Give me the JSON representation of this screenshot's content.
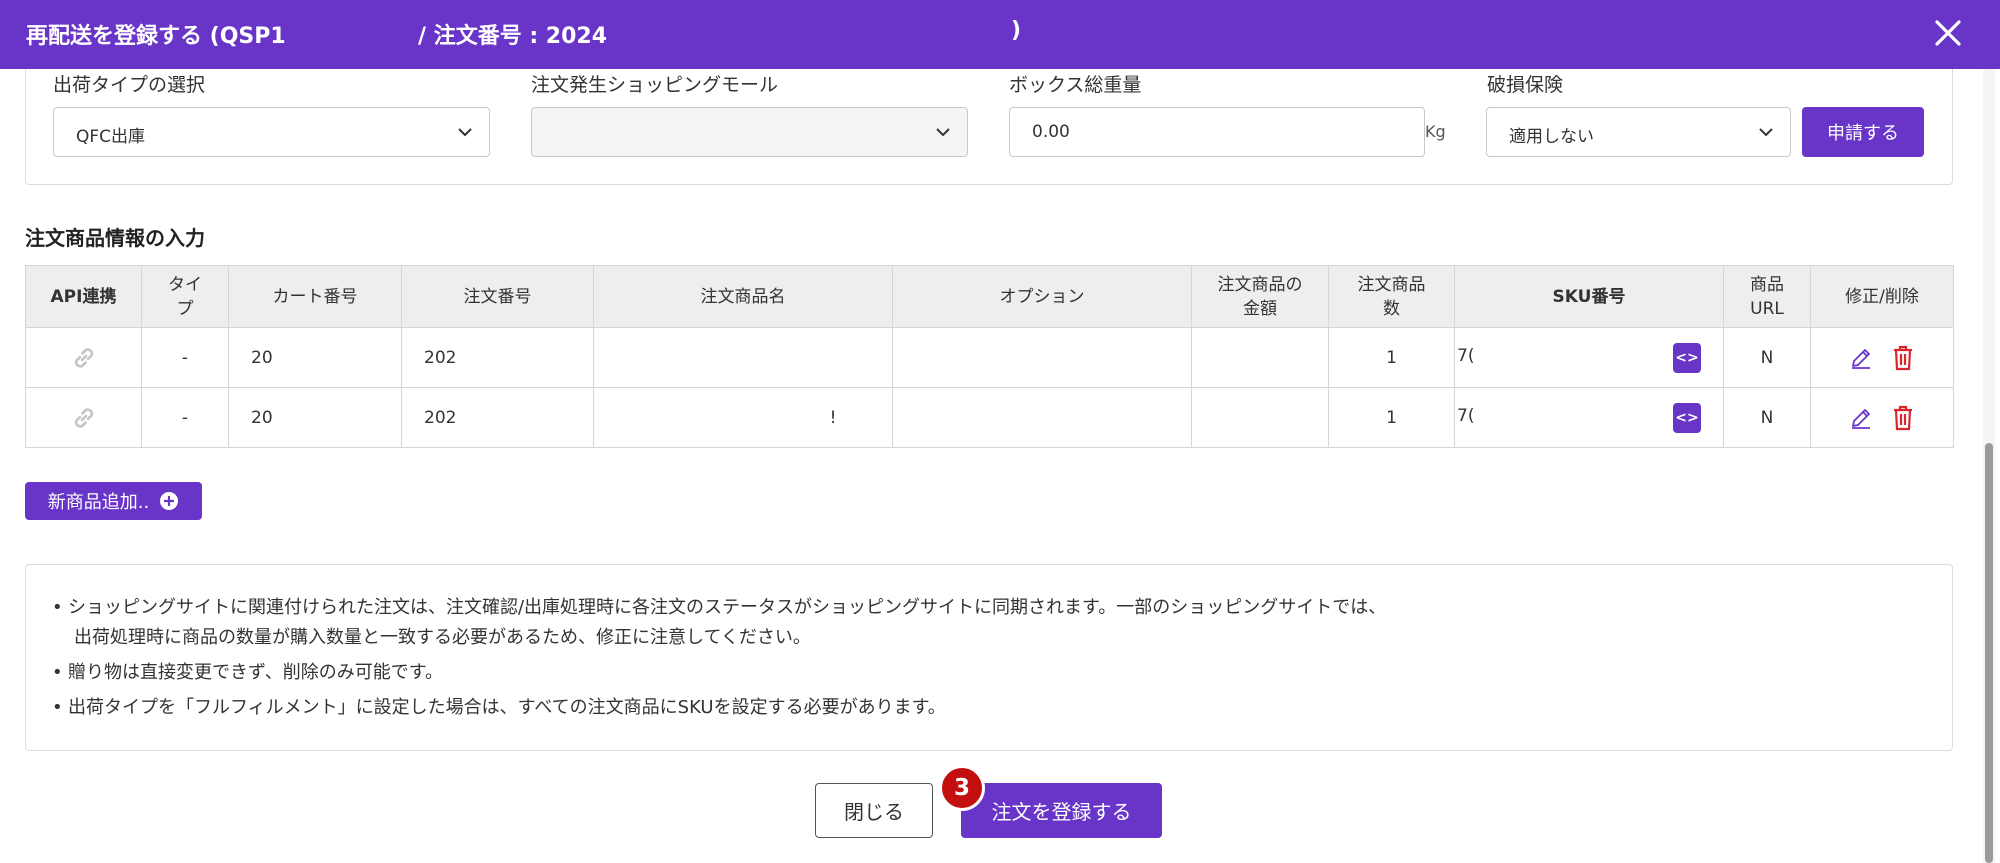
{
  "header": {
    "title_part1": "再配送を登録する (QSP1",
    "title_part2": "/ 注文番号 : 2024",
    "title_end": ")",
    "close_icon": "close-icon"
  },
  "fields": {
    "shipping_type": {
      "label": "出荷タイプの選択",
      "value": "QFC出庫"
    },
    "mall": {
      "label": "注文発生ショッピングモール",
      "value": ""
    },
    "box_weight": {
      "label": "ボックス総重量",
      "value": "0.00",
      "unit": "Kg"
    },
    "insurance": {
      "label": "破損保険",
      "value": "適用しない",
      "apply_button": "申請する"
    }
  },
  "section_title": "注文商品情報の入力",
  "table": {
    "headers": {
      "api": "API連携",
      "type_1": "タイ",
      "type_2": "プ",
      "cart": "カート番号",
      "order": "注文番号",
      "product": "注文商品名",
      "option": "オプション",
      "price_1": "注文商品の",
      "price_2": "金額",
      "qty_1": "注文商品",
      "qty_2": "数",
      "sku": "SKU番号",
      "url_1": "商品",
      "url_2": "URL",
      "edit": "修正/削除"
    },
    "rows": [
      {
        "type": "-",
        "cart": "20",
        "order": "202",
        "product": "",
        "option": "",
        "price": "",
        "qty": "1",
        "sku": "7(",
        "url": "N"
      },
      {
        "type": "-",
        "cart": "20",
        "order": "202",
        "product": "!",
        "option": "",
        "price": "",
        "qty": "1",
        "sku": "7(",
        "url": "N"
      }
    ]
  },
  "add_product_button": "新商品追加..",
  "notes": [
    "ショッピングサイトに関連付けられた注文は、注文確認/出庫処理時に各注文のステータスがショッピングサイトに同期されます。一部のショッピングサイトでは、",
    "出荷処理時に商品の数量が購入数量と一致する必要があるため、修正に注意してください。",
    "贈り物は直接変更できず、削除のみ可能です。",
    "出荷タイプを「フルフィルメント」に設定した場合は、すべての注文商品にSKUを設定する必要があります。"
  ],
  "footer": {
    "close_button": "閉じる",
    "submit_button": "注文を登録する",
    "step_badge": "3"
  },
  "colors": {
    "brand": "#6935c9",
    "delete": "#d9262c",
    "badge": "#c40f0f"
  }
}
